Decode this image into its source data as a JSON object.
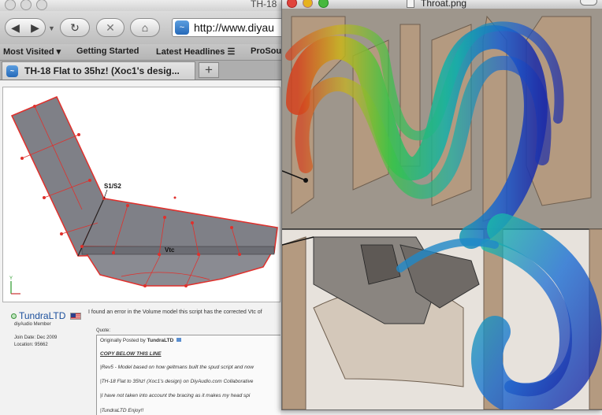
{
  "browser": {
    "window_title": "TH-18",
    "address": {
      "url": "http://www.diyau"
    },
    "nav": {
      "back_icon": "◀",
      "forward_icon": "▶",
      "reload_icon": "↻",
      "stop_icon": "✕",
      "home_icon": "⌂"
    },
    "bookmarks": [
      {
        "label": "Most Visited ▾"
      },
      {
        "label": "Getting Started"
      },
      {
        "label": "Latest Headlines ☰"
      },
      {
        "label": "ProSou"
      }
    ],
    "tab": {
      "title": "TH-18 Flat to 35hz! (Xoc1's desig..."
    },
    "new_tab_label": "+"
  },
  "cad": {
    "label_junction": "S1/S2",
    "label_vtc": "Vtc",
    "axis_label": "Y"
  },
  "post": {
    "username": "TundraLTD",
    "member_title": "diyAudio Member",
    "join_date": "Join Date: Dec 2009",
    "location": "Location: 95662",
    "text_intro": "I found an error in the Volume model this script has the corrected Vtc of",
    "quote_label": "Quote:",
    "quote_by": "Originally Posted by",
    "quote_author": "TundraLTD",
    "quote_lines": [
      "COPY BELOW THIS LINE",
      "|Rev5 - Model based on how geltmans built the spud script and now",
      "|TH-18 Flat to 35hz! (Xoc1's design) on DiyAudio.com Collaborative",
      "|I have not taken into account the bracing as it makes my head spi",
      "|TundraLTD Enjoy!!"
    ]
  },
  "preview": {
    "window_title": "Throat.png"
  },
  "colors": {
    "cad_fill": "#7f8087",
    "cad_edge": "#e0302c",
    "link_blue": "#1b4f9c",
    "wood": "#b49a80"
  }
}
